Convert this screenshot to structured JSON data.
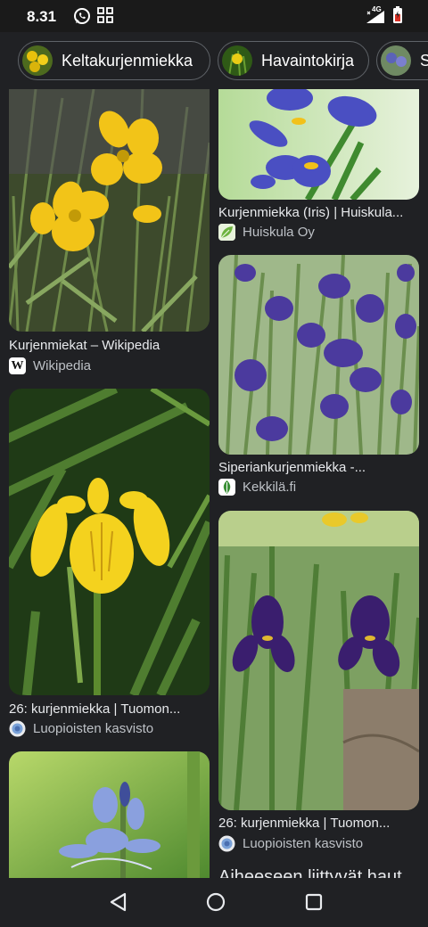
{
  "status": {
    "time": "8.31",
    "network": "4G"
  },
  "chips": [
    {
      "label": "Keltakurjenmiekka"
    },
    {
      "label": "Havaintokirja"
    },
    {
      "label": "S"
    }
  ],
  "results": {
    "left": [
      {
        "title": "Kurjenmiekat – Wikipedia",
        "source": "Wikipedia"
      },
      {
        "title": "26: kurjenmiekka | Tuomon...",
        "source": "Luopioisten kasvisto"
      }
    ],
    "right": [
      {
        "title": "Kurjenmiekka (Iris) | Huiskula...",
        "source": "Huiskula Oy"
      },
      {
        "title": "Siperiankurjenmiekka -...",
        "source": "Kekkilä.fi"
      },
      {
        "title": "26: kurjenmiekka | Tuomon...",
        "source": "Luopioisten kasvisto"
      }
    ],
    "next_section_heading": "Aiheeseen liittyvät haut"
  },
  "icons": {
    "status": [
      "whatsapp-icon",
      "grid-icon",
      "signal-icon",
      "battery-icon"
    ],
    "nav": [
      "back-icon",
      "home-icon",
      "recents-icon"
    ],
    "sources": [
      "wikipedia-icon",
      "huiskula-icon",
      "kekkila-icon",
      "globe-icon"
    ]
  },
  "colors": {
    "background": "#202124",
    "chip_border": "#5f6368",
    "text": "#e8eaed",
    "secondary_text": "#bdc1c6"
  }
}
